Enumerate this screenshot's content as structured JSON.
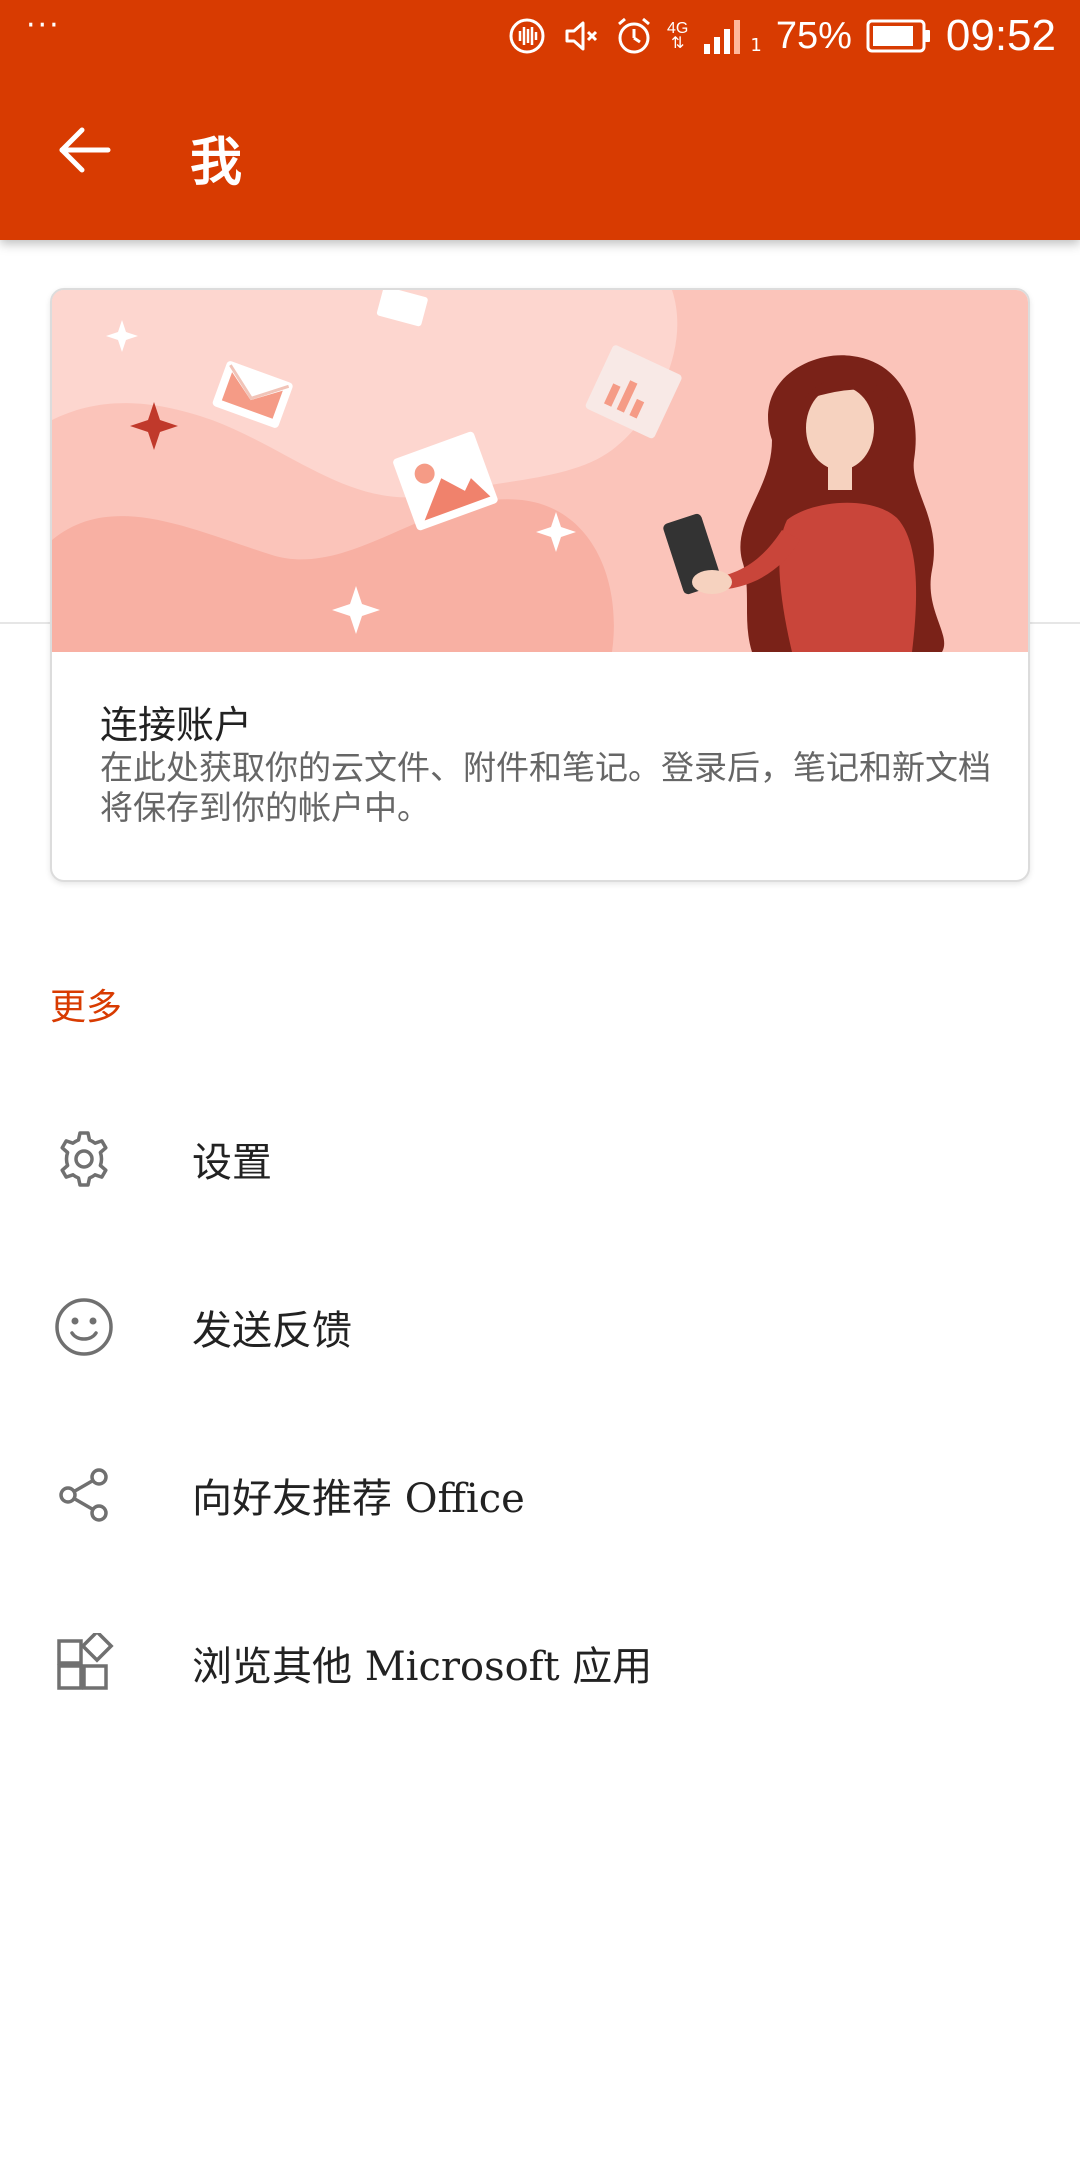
{
  "status_bar": {
    "dots": "···",
    "network": "4G",
    "sim_slot": "1",
    "battery": "75%",
    "time": "09:52"
  },
  "app_bar": {
    "title": "我",
    "back_icon": "arrow-back-icon"
  },
  "account_card": {
    "title": "连接账户",
    "description": "在此处获取你的云文件、附件和笔记。登录后，笔记和新文档将保存到你的帐户中。"
  },
  "more_section": {
    "header": "更多",
    "items": [
      {
        "label": "设置",
        "icon": "gear-icon"
      },
      {
        "label": "发送反馈",
        "icon": "smiley-icon"
      },
      {
        "label": "向好友推荐 Office",
        "icon": "share-icon"
      },
      {
        "label": "浏览其他 Microsoft 应用",
        "icon": "apps-icon"
      }
    ]
  },
  "colors": {
    "accent": "#D83B01",
    "illustration_bg": "#FBC4BA"
  }
}
